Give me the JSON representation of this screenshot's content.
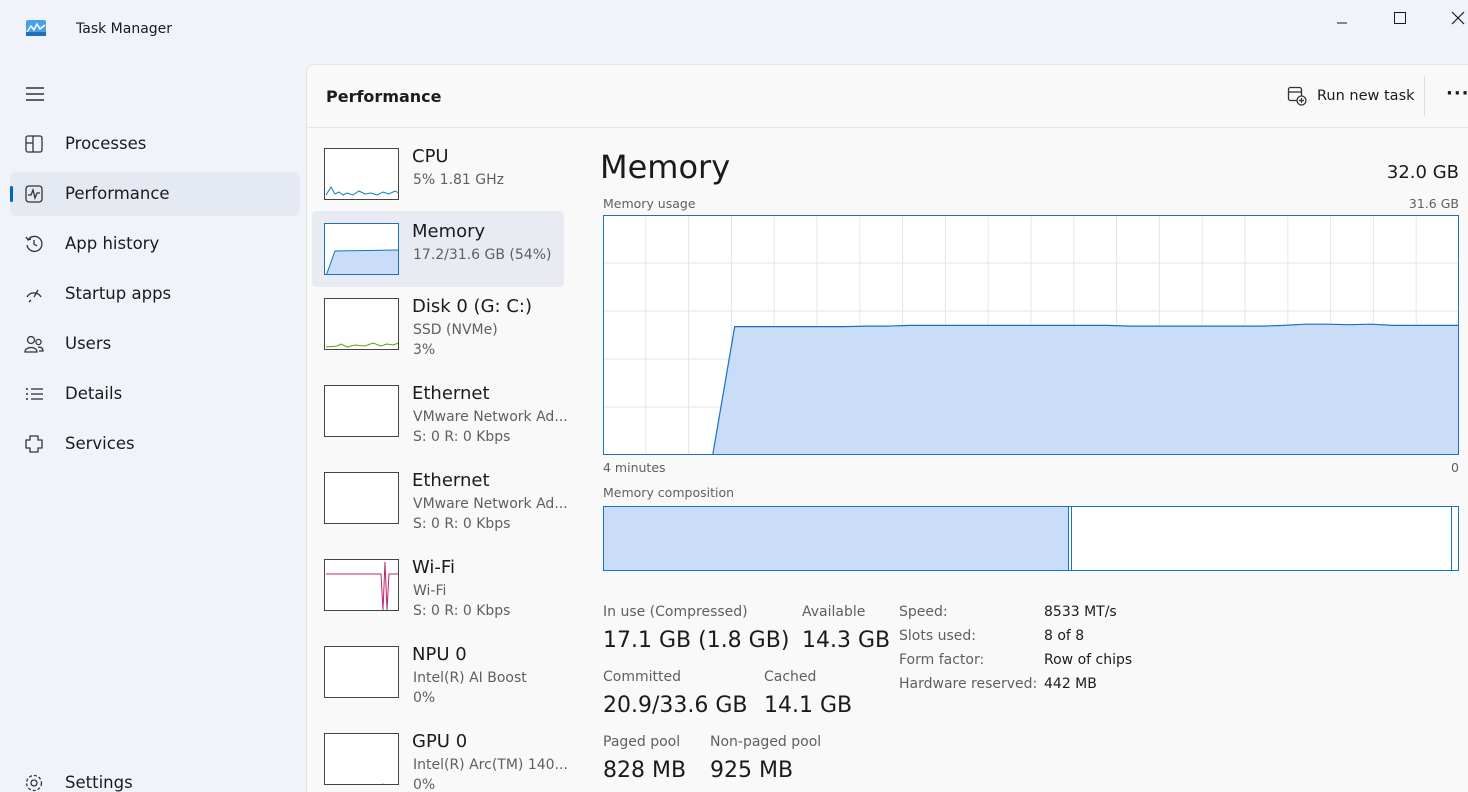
{
  "window": {
    "title": "Task Manager"
  },
  "nav": {
    "items": [
      {
        "label": "Processes",
        "icon": "processes-icon"
      },
      {
        "label": "Performance",
        "icon": "performance-icon",
        "active": true
      },
      {
        "label": "App history",
        "icon": "history-icon"
      },
      {
        "label": "Startup apps",
        "icon": "startup-icon"
      },
      {
        "label": "Users",
        "icon": "users-icon"
      },
      {
        "label": "Details",
        "icon": "details-icon"
      },
      {
        "label": "Services",
        "icon": "services-icon"
      }
    ],
    "settings": "Settings"
  },
  "header": {
    "title": "Performance",
    "run_new_task": "Run new task"
  },
  "devices": [
    {
      "name": "CPU",
      "lines": [
        "5%  1.81 GHz"
      ],
      "color": "#117dbb"
    },
    {
      "name": "Memory",
      "lines": [
        "17.2/31.6 GB (54%)"
      ],
      "color": "#1c6fc5",
      "active": true
    },
    {
      "name": "Disk 0 (G: C:)",
      "lines": [
        "SSD (NVMe)",
        "3%"
      ],
      "color": "#4da60c"
    },
    {
      "name": "Ethernet",
      "lines": [
        "VMware Network Ad...",
        "S: 0 R: 0 Kbps"
      ],
      "color": "#a74f01"
    },
    {
      "name": "Ethernet",
      "lines": [
        "VMware Network Ad...",
        "S: 0 R: 0 Kbps"
      ],
      "color": "#a74f01"
    },
    {
      "name": "Wi-Fi",
      "lines": [
        "Wi-Fi",
        "S: 0 R: 0 Kbps"
      ],
      "color": "#c1246d"
    },
    {
      "name": "NPU 0",
      "lines": [
        "Intel(R) AI Boost",
        "0%"
      ],
      "color": "#117dbb"
    },
    {
      "name": "GPU 0",
      "lines": [
        "Intel(R) Arc(TM) 140...",
        "0%"
      ],
      "color": "#117dbb"
    }
  ],
  "memory": {
    "title": "Memory",
    "total": "32.0 GB",
    "usage_label": "Memory usage",
    "usage_max": "31.6 GB",
    "time_start": "4 minutes",
    "time_end": "0",
    "composition_label": "Memory composition",
    "usage_fraction_history": [
      0,
      0,
      0,
      0,
      0,
      0,
      0.535,
      0.535,
      0.535,
      0.535,
      0.535,
      0.535,
      0.537,
      0.537,
      0.54,
      0.54,
      0.54,
      0.54,
      0.54,
      0.54,
      0.54,
      0.54,
      0.54,
      0.54,
      0.537,
      0.537,
      0.537,
      0.537,
      0.537,
      0.537,
      0.537,
      0.54,
      0.545,
      0.545,
      0.543,
      0.545,
      0.54,
      0.54,
      0.54,
      0.54
    ],
    "composition": {
      "in_use_fraction": 0.545,
      "modified_fraction": 0.003,
      "standby_fraction": 0.445,
      "free_fraction": 0.007
    },
    "stats": {
      "in_use_label": "In use (Compressed)",
      "in_use": "17.1 GB (1.8 GB)",
      "available_label": "Available",
      "available": "14.3 GB",
      "committed_label": "Committed",
      "committed": "20.9/33.6 GB",
      "cached_label": "Cached",
      "cached": "14.1 GB",
      "paged_label": "Paged pool",
      "paged": "828 MB",
      "nonpaged_label": "Non-paged pool",
      "nonpaged": "925 MB"
    },
    "properties": [
      {
        "label": "Speed:",
        "value": "8533 MT/s"
      },
      {
        "label": "Slots used:",
        "value": "8 of 8"
      },
      {
        "label": "Form factor:",
        "value": "Row of chips"
      },
      {
        "label": "Hardware reserved:",
        "value": "442 MB"
      }
    ]
  },
  "colors": {
    "accent": "#0067c0",
    "memory_line": "#1c6fc5",
    "memory_fill": "#c9ddf8"
  }
}
